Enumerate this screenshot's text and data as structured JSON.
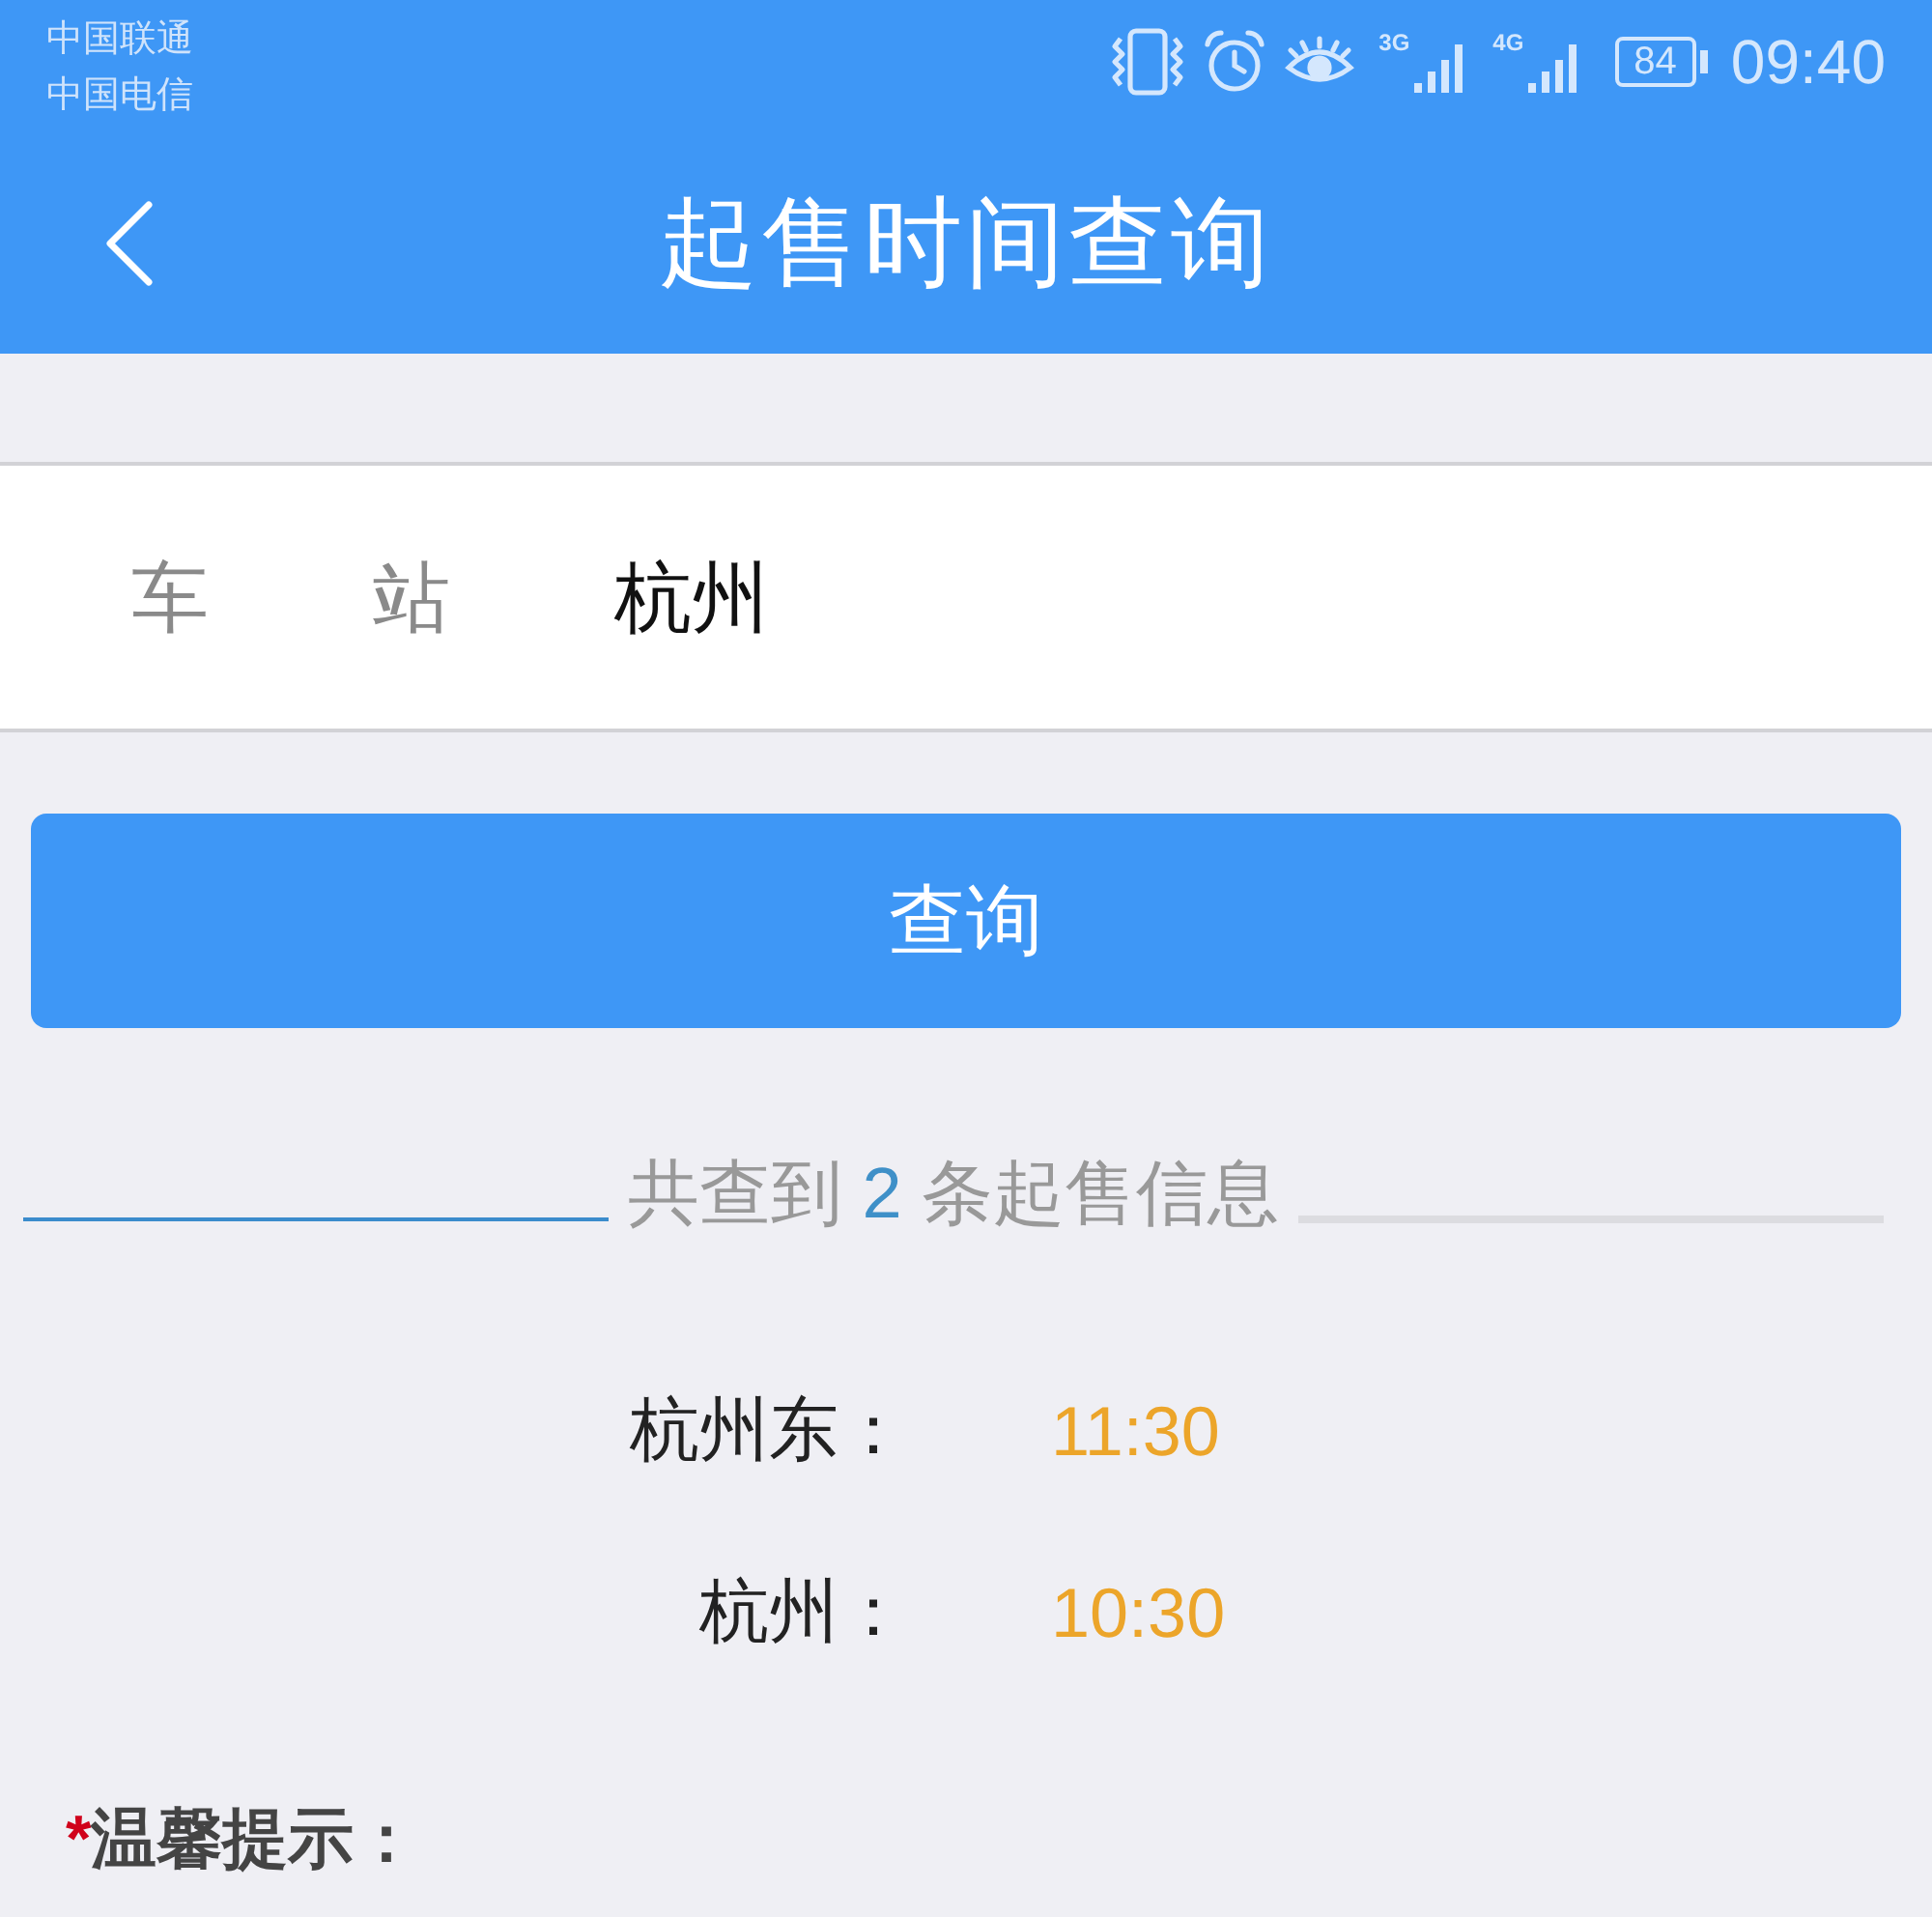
{
  "status_bar": {
    "carriers": [
      "中国联通",
      "中国电信"
    ],
    "networks": [
      {
        "label": "3G"
      },
      {
        "label": "4G"
      }
    ],
    "battery": "84",
    "time": "09:40"
  },
  "header": {
    "title": "起售时间查询"
  },
  "station_field": {
    "label": "车 站",
    "value": "杭州"
  },
  "query_button": {
    "label": "查询"
  },
  "summary": {
    "prefix": "共查到",
    "count": "2",
    "suffix": "条起售信息"
  },
  "results": [
    {
      "station": "杭州东：",
      "time": "11:30"
    },
    {
      "station": "杭州：",
      "time": "10:30"
    }
  ],
  "tip": {
    "marker": "*",
    "title": "温馨提示："
  }
}
